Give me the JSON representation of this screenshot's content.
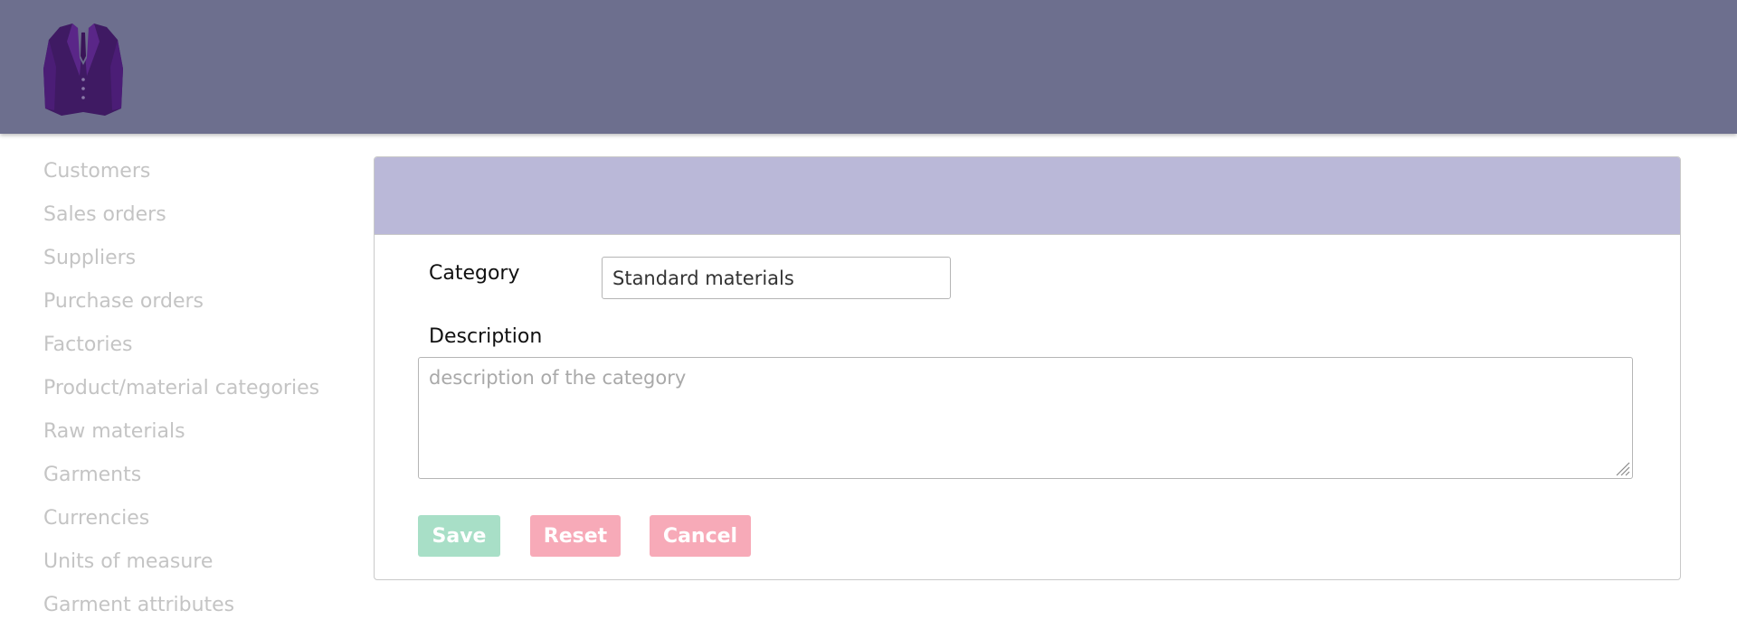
{
  "header": {
    "logo_icon": "suit-jacket-logo-icon",
    "background": "#6d6f8e"
  },
  "sidebar": {
    "items": [
      {
        "label": "Customers"
      },
      {
        "label": "Sales orders"
      },
      {
        "label": "Suppliers"
      },
      {
        "label": "Purchase orders"
      },
      {
        "label": "Factories"
      },
      {
        "label": "Product/material categories"
      },
      {
        "label": "Raw materials"
      },
      {
        "label": "Garments"
      },
      {
        "label": "Currencies"
      },
      {
        "label": "Units of measure"
      },
      {
        "label": "Garment attributes"
      }
    ]
  },
  "form": {
    "heading_color": "#bab8d8",
    "category_label": "Category",
    "category_value": "Standard materials",
    "description_label": "Description",
    "description_value": "",
    "description_placeholder": "description of the category",
    "buttons": {
      "save_label": "Save",
      "save_color": "#a8dfc7",
      "reset_label": "Reset",
      "reset_color": "#f7aab8",
      "cancel_label": "Cancel",
      "cancel_color": "#f7aab8"
    }
  }
}
